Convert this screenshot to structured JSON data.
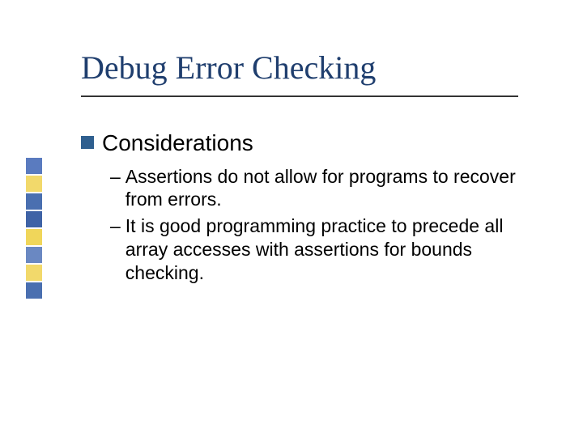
{
  "slide": {
    "title": "Debug Error Checking",
    "level1": "Considerations",
    "items": [
      "Assertions do not allow for programs to recover from errors.",
      "It is good programming practice to precede all array accesses with assertions for bounds checking."
    ]
  },
  "deco_colors": [
    "#5a7bbf",
    "#f2d96b",
    "#4a6fb0",
    "#3f63a6",
    "#f0d65a",
    "#6a88c2",
    "#f2d96b",
    "#4a6fb0"
  ]
}
